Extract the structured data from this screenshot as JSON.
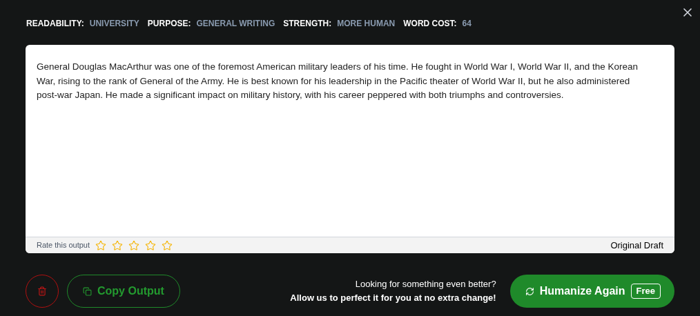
{
  "settings": [
    {
      "label": "READABILITY:",
      "value": "UNIVERSITY"
    },
    {
      "label": "PURPOSE:",
      "value": "GENERAL WRITING"
    },
    {
      "label": "STRENGTH:",
      "value": "MORE HUMAN"
    },
    {
      "label": "WORD COST:",
      "value": "64"
    }
  ],
  "output": {
    "text": "General Douglas MacArthur was one of the foremost American military leaders of his time. He fought in World War I, World War II, and the Korean War, rising to the rank of General of the Army. He is best known for his leadership in the Pacific theater of World War II, but he also administered post-war Japan. He made a significant impact on military history, with his career peppered with both triumphs and controversies.",
    "rating_label": "Rate this output",
    "stars": 0,
    "draft_label": "Original Draft"
  },
  "copy_button": "Copy Output",
  "promo": {
    "line_1": "Looking for something even better?",
    "line_2": "Allow us to perfect it for you at no extra change!"
  },
  "humanize_button": {
    "label": "Humanize Again",
    "badge": "Free"
  }
}
